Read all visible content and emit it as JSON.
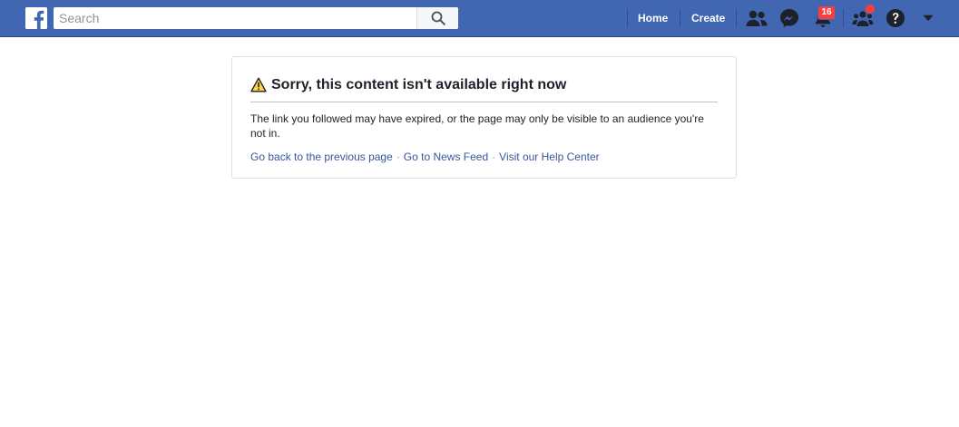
{
  "colors": {
    "topbar": "#4267b2",
    "topbar_border": "#29487d",
    "link": "#365899",
    "badge": "#fa3e3e",
    "text": "#1d2129",
    "nav_icon": "#1d2129"
  },
  "topbar": {
    "logo_icon": "facebook-logo-icon",
    "search": {
      "placeholder": "Search",
      "value": "",
      "button_icon": "magnifier-icon"
    },
    "nav": {
      "home_label": "Home",
      "create_label": "Create"
    },
    "icons": {
      "friends": "friend-requests-icon",
      "messenger": "messenger-icon",
      "notifications": "bell-icon",
      "groups": "groups-icon",
      "help": "question-mark-icon",
      "account_menu": "caret-down-icon"
    },
    "notifications_count": "16"
  },
  "card": {
    "icon": "warning-triangle-icon",
    "title": "Sorry, this content isn't available right now",
    "body": "The link you followed may have expired, or the page may only be visible to an audience you're not in.",
    "links": {
      "go_back": "Go back to the previous page",
      "separator": "·",
      "news_feed": "Go to News Feed",
      "help_center": "Visit our Help Center"
    }
  }
}
